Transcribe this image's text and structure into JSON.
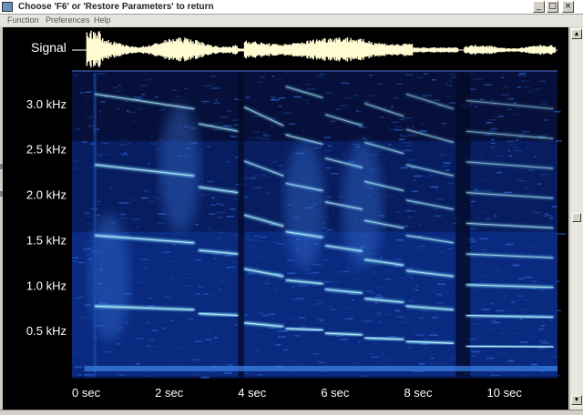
{
  "window": {
    "title": "Choose 'F6' or 'Restore Parameters' to return",
    "minimize_glyph": "_",
    "restore_glyph": "□",
    "close_glyph": "×"
  },
  "menu": {
    "items": [
      "Function",
      "Preferences",
      "Help"
    ]
  },
  "plot": {
    "signal_label": "Signal",
    "background_color": "#000000",
    "spectrogram_color": "#1e6ee0",
    "harmonic_color": "#7fe0ff",
    "waveform_color": "#fffbd2"
  },
  "chart_data": {
    "type": "heatmap",
    "title": "",
    "xlabel": "",
    "ylabel": "",
    "x_unit": "sec",
    "y_unit": "kHz",
    "x_ticks": [
      0,
      2,
      4,
      6,
      8,
      10
    ],
    "x_tick_labels": [
      "0",
      "2",
      "4",
      "6",
      "8",
      "10"
    ],
    "y_ticks": [
      0.5,
      1.0,
      1.5,
      2.0,
      2.5,
      3.0
    ],
    "y_tick_labels": [
      "0.5 kHz",
      "1.0 kHz",
      "1.5 kHz",
      "2.0 kHz",
      "2.5 kHz",
      "3.0 kHz"
    ],
    "xlim": [
      0,
      11.7
    ],
    "ylim": [
      0,
      3.35
    ],
    "grid": false
  },
  "icons": {
    "app": "app-icon",
    "scroll_up": "scroll-up-icon",
    "scroll_down": "scroll-down-icon"
  }
}
